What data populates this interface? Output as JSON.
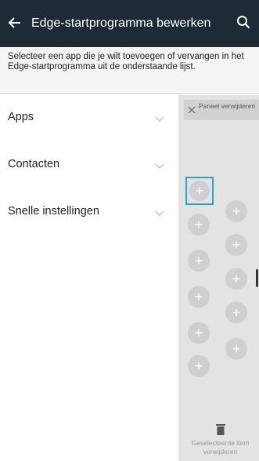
{
  "header": {
    "title": "Edge-startprogramma bewerken",
    "back_icon": "back-arrow-icon",
    "search_icon": "search-icon"
  },
  "description": "Selecteer een app die je wilt toevoegen of vervangen in het Edge-startprogramma uit de onderstaande lijst.",
  "categories": [
    {
      "label": "Apps",
      "icon": "chevron-down-icon"
    },
    {
      "label": "Contacten",
      "icon": "chevron-down-icon"
    },
    {
      "label": "Snelle instellingen",
      "icon": "chevron-down-icon"
    }
  ],
  "panel": {
    "remove_panel_label": "Paneel verwijderen",
    "add_symbol": "+",
    "delete_selected_label": "Geselecteerde item verwijderen",
    "colors": {
      "header_bg": "#1e2a36",
      "selection_frame": "#27a5dc",
      "panel_bg": "#e3e3e3",
      "slot": "#cfcfcf"
    }
  }
}
